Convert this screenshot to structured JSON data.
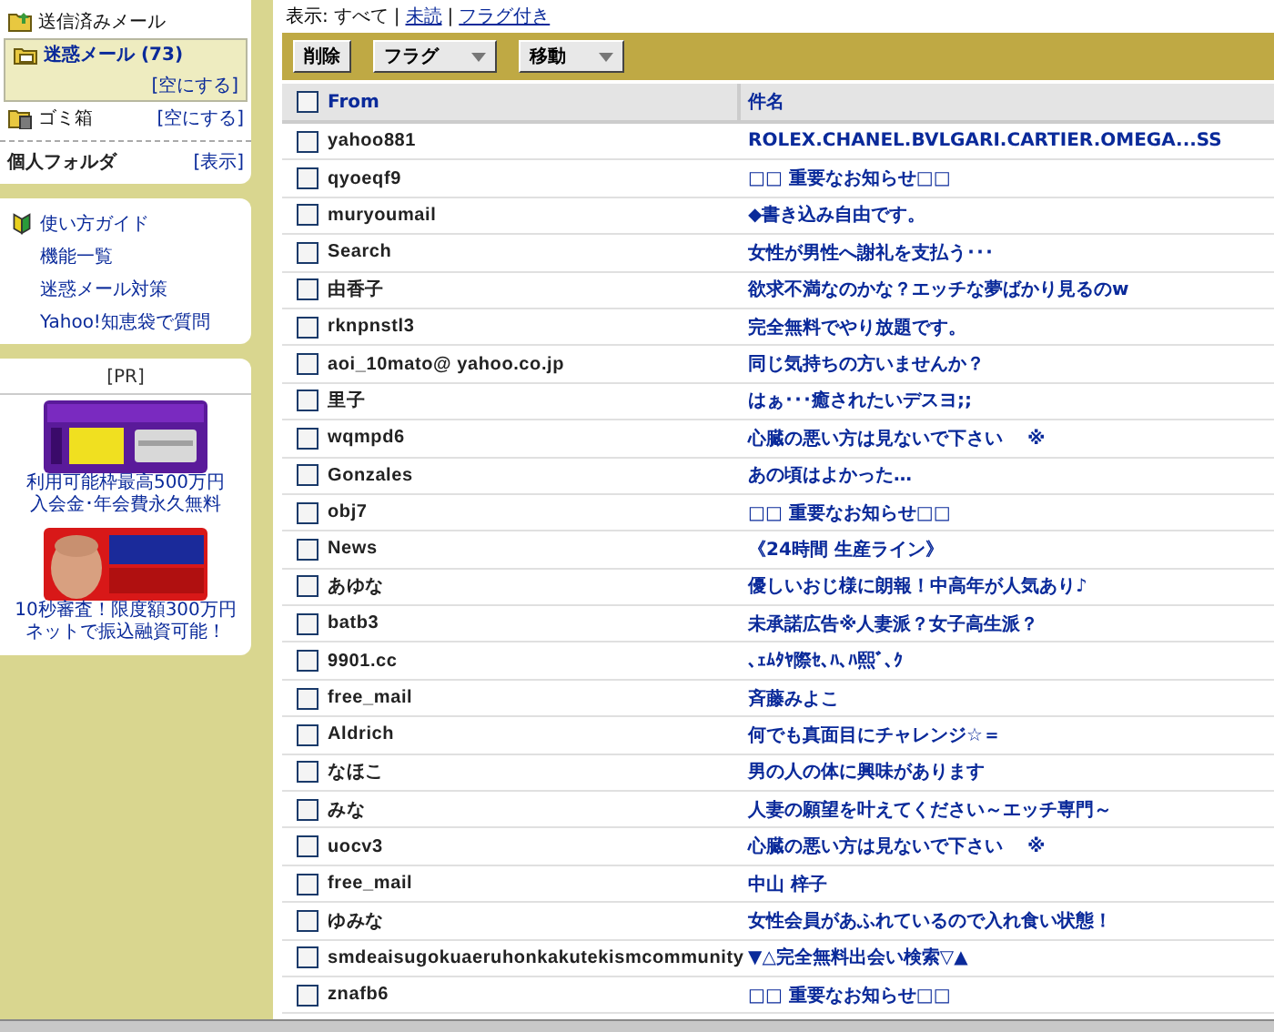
{
  "sidebar": {
    "folders": [
      {
        "name": "送信済みメール",
        "selected": false
      },
      {
        "name": "迷惑メール (73)",
        "selected": true,
        "action": "[空にする]"
      },
      {
        "name": "ゴミ箱",
        "selected": false,
        "action": "[空にする]"
      }
    ],
    "personal": {
      "label": "個人フォルダ",
      "action": "[表示]"
    },
    "guide_links": [
      "使い方ガイド",
      "機能一覧",
      "迷惑メール対策",
      "Yahoo!知恵袋で質問"
    ],
    "pr": {
      "label": "[PR]",
      "ads": [
        {
          "kind": "picture",
          "caption": [
            "利用可能枠最高500万円",
            "入会金･年会費永久無料"
          ]
        },
        {
          "kind": "picture",
          "caption": [
            "10秒審査！限度額300万円",
            "ネットで振込融資可能！"
          ]
        }
      ]
    }
  },
  "view_filter": {
    "label": "表示:",
    "options": [
      {
        "label": "すべて",
        "selected": true
      },
      {
        "separator": "|",
        "label": "未読",
        "selected": false
      },
      {
        "separator": "|",
        "label": "フラグ付き",
        "selected": false
      }
    ]
  },
  "toolbar": [
    {
      "label": "削除",
      "kind": "button"
    },
    {
      "label": "フラグ",
      "kind": "dropdown"
    },
    {
      "label": "移動",
      "kind": "dropdown"
    }
  ],
  "table": {
    "columns": [
      "From",
      "件名"
    ],
    "select_all_checked": false,
    "rows": [
      {
        "from": "yahoo881",
        "subject": "ROLEX.CHANEL.BVLGARI.CARTIER.OMEGA...SS",
        "checked": false
      },
      {
        "from": "qyoeqf9",
        "subject": "□□ 重要なお知らせ□□",
        "checked": false
      },
      {
        "from": "muryoumail",
        "subject": "◆書き込み自由です。",
        "checked": false
      },
      {
        "from": "Search",
        "subject": "女性が男性へ謝礼を支払う･･･",
        "checked": false
      },
      {
        "from": "由香子",
        "subject": "欲求不満なのかな？エッチな夢ばかり見るのw",
        "checked": false
      },
      {
        "from": "rknpnstl3",
        "subject": "完全無料でやり放題です。",
        "checked": false
      },
      {
        "from": "aoi_10mato@ yahoo.co.jp",
        "subject": "同じ気持ちの方いませんか？",
        "checked": false
      },
      {
        "from": "里子",
        "subject": "はぁ･･･癒されたいデスヨ;;",
        "checked": false
      },
      {
        "from": "wqmpd6",
        "subject": "心臓の悪い方は見ないで下さい　 ※",
        "checked": false
      },
      {
        "from": "Gonzales",
        "subject": "あの頃はよかった…",
        "checked": false
      },
      {
        "from": "obj7",
        "subject": "□□ 重要なお知らせ□□",
        "checked": false
      },
      {
        "from": "News",
        "subject": "《24時間 生産ライン》",
        "checked": false
      },
      {
        "from": "あゆな",
        "subject": "優しいおじ様に朗報！中高年が人気あり♪",
        "checked": false
      },
      {
        "from": "batb3",
        "subject": "未承諾広告※人妻派？女子高生派？",
        "checked": false
      },
      {
        "from": "9901.cc",
        "subject": "､ｪﾑﾀﾔ際ｾ､ﾊ､ﾊ熙ﾞ､ｸ",
        "checked": false
      },
      {
        "from": "free_mail",
        "subject": "斉藤みよこ",
        "checked": false
      },
      {
        "from": "Aldrich",
        "subject": "何でも真面目にチャレンジ☆＝",
        "checked": false
      },
      {
        "from": "なほこ",
        "subject": "男の人の体に興味があります",
        "checked": false
      },
      {
        "from": "みな",
        "subject": "人妻の願望を叶えてください～エッチ専門～",
        "checked": false
      },
      {
        "from": "uocv3",
        "subject": "心臓の悪い方は見ないで下さい　 ※",
        "checked": false
      },
      {
        "from": "free_mail",
        "subject": "中山 梓子",
        "checked": false
      },
      {
        "from": "ゆみな",
        "subject": "女性会員があふれているので入れ食い状態！",
        "checked": false
      },
      {
        "from": "smdeaisugokuaeruhonkakutekismcommunity",
        "subject": "▼△完全無料出会い検索▽▲",
        "checked": false
      },
      {
        "from": "znafb6",
        "subject": "□□ 重要なお知らせ□□",
        "checked": false
      }
    ]
  }
}
